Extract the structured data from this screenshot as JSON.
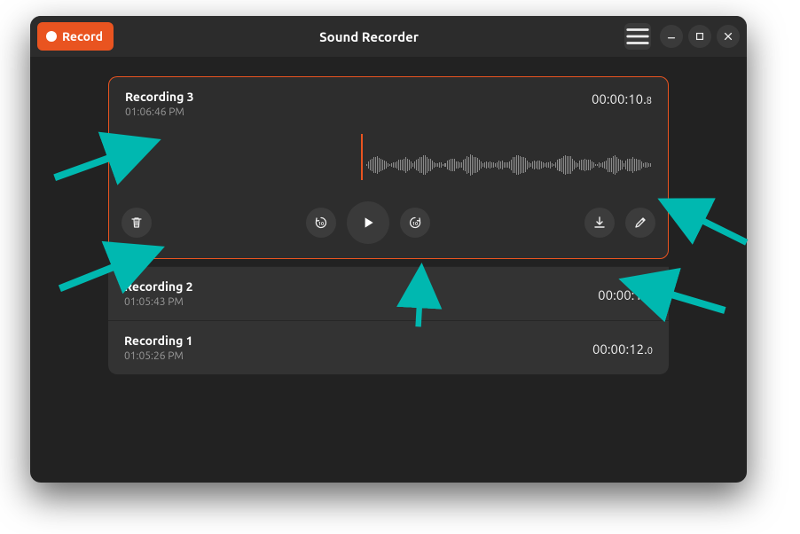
{
  "header": {
    "record_label": "Record",
    "title": "Sound Recorder"
  },
  "expanded": {
    "name": "Recording 3",
    "time": "01:06:46 PM",
    "duration_main": "00:00:10.",
    "duration_frac": "8"
  },
  "recordings": [
    {
      "name": "Recording 2",
      "time": "01:05:43 PM",
      "duration_main": "00:00:11.",
      "duration_frac": ""
    },
    {
      "name": "Recording 1",
      "time": "01:05:26 PM",
      "duration_main": "00:00:12.",
      "duration_frac": "0"
    }
  ],
  "icons": {
    "menu": "menu-icon",
    "min": "minimize-icon",
    "max": "maximize-icon",
    "close": "close-icon",
    "delete": "trash-icon",
    "back10": "skip-back-10-icon",
    "play": "play-icon",
    "fwd10": "skip-forward-10-icon",
    "export": "download-icon",
    "rename": "edit-icon"
  },
  "colors": {
    "accent": "#e95420",
    "arrow": "#00b8b0"
  }
}
